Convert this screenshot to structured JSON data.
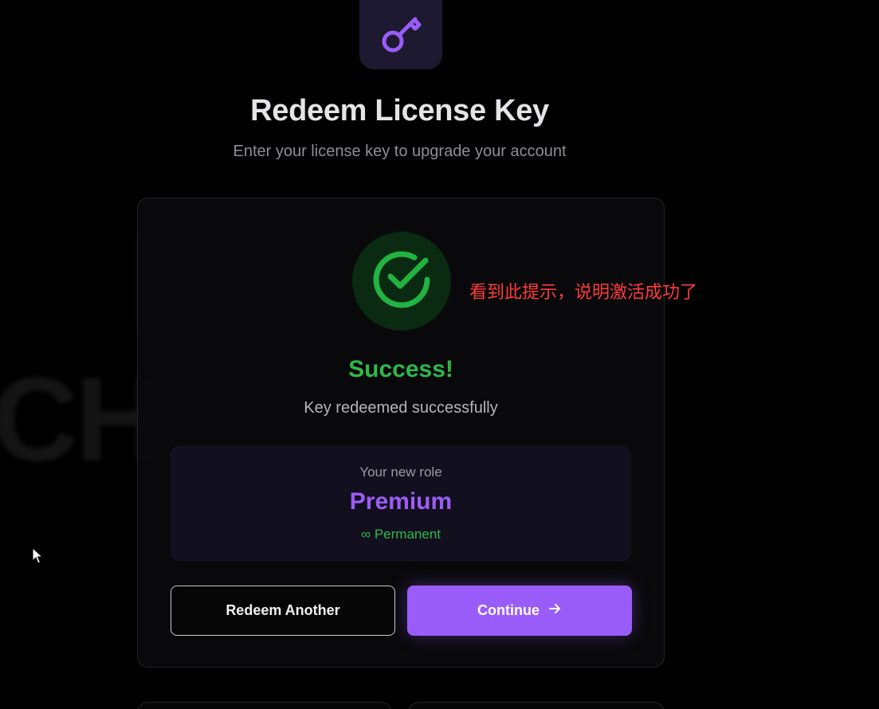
{
  "header": {
    "title": "Redeem License Key",
    "subtitle": "Enter your license key to upgrade your account",
    "icon": "key-icon"
  },
  "result": {
    "icon": "check-circle-icon",
    "title": "Success!",
    "message": "Key redeemed successfully",
    "role_label": "Your new role",
    "role_value": "Premium",
    "duration_symbol": "∞",
    "duration_label": "Permanent"
  },
  "actions": {
    "redeem_another_label": "Redeem Another",
    "continue_label": "Continue",
    "continue_icon": "arrow-right-icon"
  },
  "annotation": {
    "text": "看到此提示，说明激活成功了"
  },
  "colors": {
    "accent": "#9a5cf8",
    "success": "#2fb84a",
    "annotation": "#ff3b3b",
    "background": "#000000"
  }
}
